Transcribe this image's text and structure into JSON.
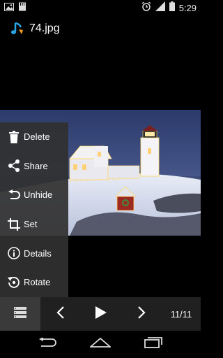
{
  "status_bar": {
    "time": "5:29",
    "left_icons": [
      "photo-notification-icon",
      "storage-notification-icon"
    ],
    "right_icons": [
      "alarm-icon",
      "signal-icon",
      "battery-icon"
    ]
  },
  "title_bar": {
    "app_icon": "music-note-icon",
    "title": "74.jpg"
  },
  "photo": {
    "description_icon": "image"
  },
  "menu": {
    "items": [
      {
        "label": "Delete",
        "icon": "trash-icon"
      },
      {
        "label": "Share",
        "icon": "share-icon"
      },
      {
        "label": "Unhide",
        "icon": "undo-icon"
      },
      {
        "label": "Set",
        "icon": "crop-icon"
      },
      {
        "label": "Details",
        "icon": "info-icon"
      },
      {
        "label": "Rotate",
        "icon": "rotate-icon"
      }
    ]
  },
  "controls": {
    "menu_icon": "menu-list-icon",
    "prev_icon": "chevron-left-icon",
    "play_icon": "play-icon",
    "next_icon": "chevron-right-icon",
    "counter": "11/11"
  },
  "nav_bar": {
    "icons": [
      "back-icon",
      "home-icon",
      "recents-icon"
    ]
  },
  "colors": {
    "menu_bg": "#303030",
    "controls_bg": "#202020",
    "menu_toggle_bg": "#3a3a3a",
    "app_icon_blue": "#2aa5e6",
    "app_icon_orange": "#f39c12"
  }
}
